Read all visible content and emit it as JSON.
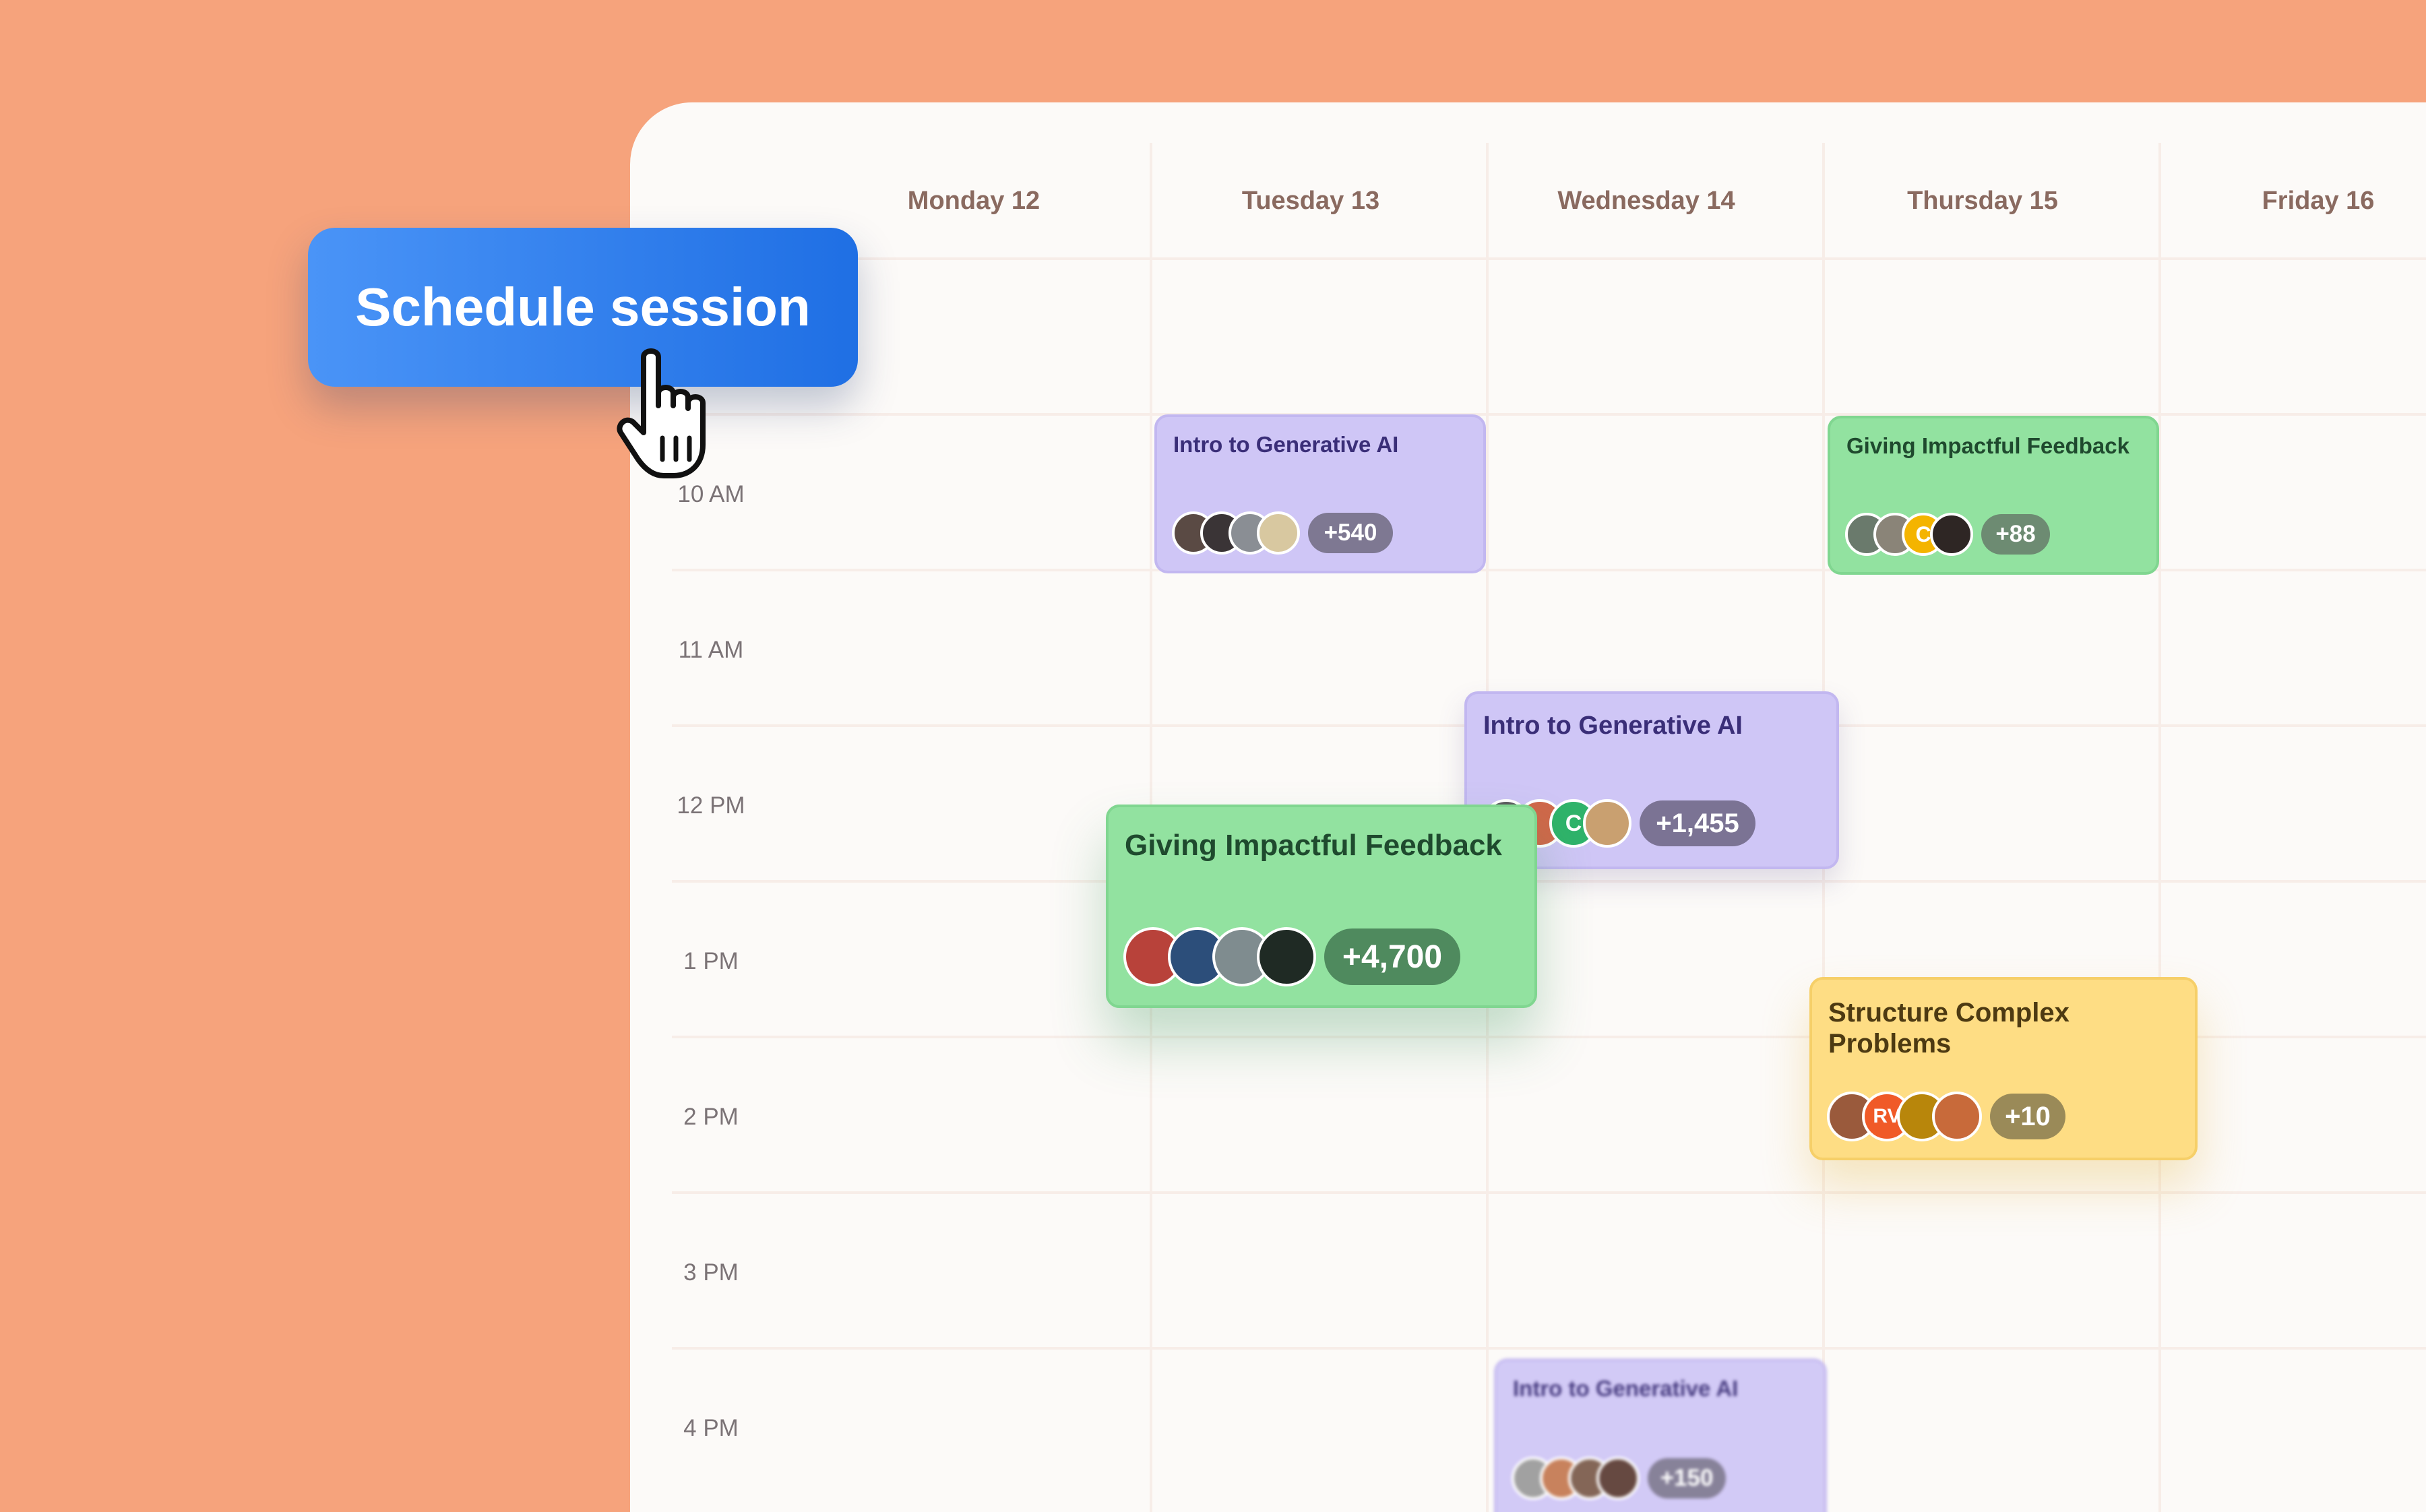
{
  "calendar": {
    "days": [
      "Monday 12",
      "Tuesday 13",
      "Wednesday 14",
      "Thursday 15",
      "Friday 16"
    ],
    "times": [
      "10 AM",
      "11 AM",
      "12 PM",
      "1 PM",
      "2 PM",
      "3 PM",
      "4 PM"
    ]
  },
  "schedule_button": {
    "label": "Schedule session"
  },
  "cursor": {
    "icon": "hand-pointer-icon"
  },
  "colors": {
    "background": "#f6a37c",
    "panel": "#fcfaf8",
    "button": "#2b7df0",
    "event_purple": "#cfc6f6",
    "event_green": "#92e2a0",
    "event_yellow": "#fedd84"
  },
  "events": [
    {
      "title": "Intro to Generative AI",
      "day": "Tuesday 13",
      "count": "+540",
      "color": "purple",
      "avatars": [
        "avatar",
        "avatar",
        "avatar",
        "avatar"
      ]
    },
    {
      "title": "Giving Impactful Feedback",
      "day": "Thursday 15",
      "count": "+88",
      "color": "green",
      "avatars": [
        "avatar",
        "avatar",
        "C",
        "avatar"
      ]
    },
    {
      "title": "Intro to Generative AI",
      "day": "Wednesday 14",
      "count": "+1,455",
      "color": "purple",
      "avatars": [
        "avatar",
        "avatar",
        "C",
        "avatar"
      ]
    },
    {
      "title": "Giving Impactful Feedback",
      "day": "Tuesday 13",
      "count": "+4,700",
      "color": "green",
      "avatars": [
        "avatar",
        "avatar",
        "avatar",
        "avatar"
      ]
    },
    {
      "title": "Structure Complex Problems",
      "day": "Thursday 15",
      "count": "+10",
      "color": "yellow",
      "avatars": [
        "avatar",
        "RV",
        "avatar",
        "avatar"
      ]
    },
    {
      "title": "Intro to Generative AI",
      "day": "Wednesday 14",
      "count": "+150",
      "color": "purple",
      "avatars": [
        "avatar",
        "avatar",
        "avatar",
        "avatar"
      ]
    }
  ]
}
